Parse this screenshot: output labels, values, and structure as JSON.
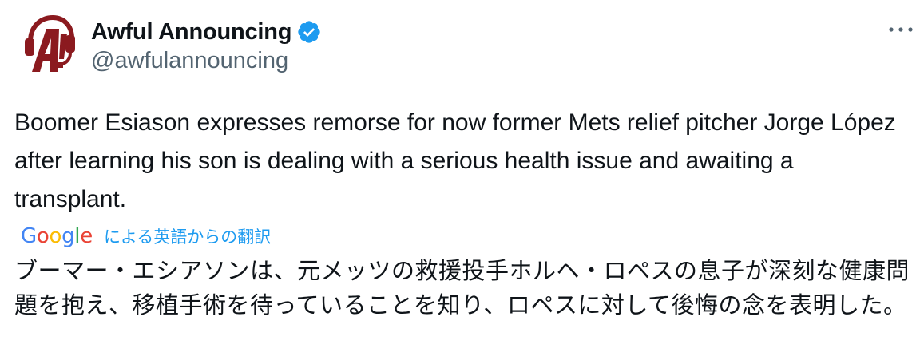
{
  "author": {
    "display_name": "Awful Announcing",
    "handle": "@awfulannouncing",
    "verified": true,
    "avatar_icon": "awful-announcing-logo",
    "brand_color": "#8b1a1f"
  },
  "menu": {
    "icon": "more-horizontal-icon"
  },
  "tweet": {
    "text": "Boomer Esiason expresses remorse for now former Mets relief pitcher Jorge López after learning his son is dealing with a serious health issue and awaiting a transplant."
  },
  "translation": {
    "provider_letters": [
      "G",
      "o",
      "o",
      "g",
      "l",
      "e"
    ],
    "label": "による英語からの翻訳",
    "link_color": "#1d9bf0",
    "text": "ブーマー・エシアソンは、元メッツの救援投手ホルヘ・ロペスの息子が深刻な健康問題を抱え、移植手術を待っていることを知り、ロペスに対して後悔の念を表明した。"
  },
  "colors": {
    "text_primary": "#0f1419",
    "text_secondary": "#536471",
    "verified_badge": "#1d9bf0"
  }
}
